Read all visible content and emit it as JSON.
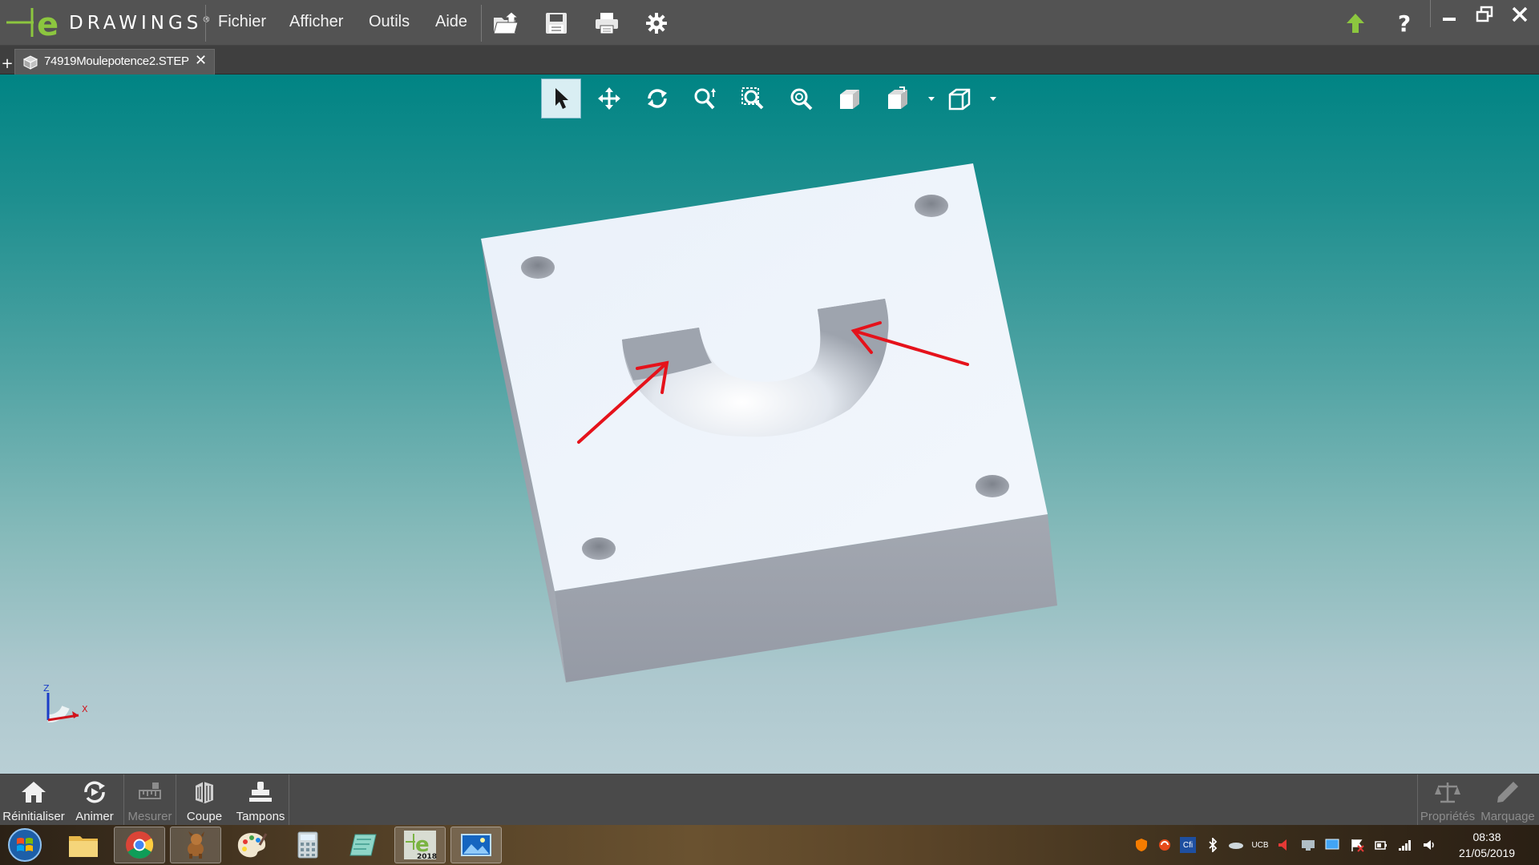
{
  "app": {
    "logo_letter": "e",
    "logo_name": "DRAWINGS",
    "logo_mark": "®"
  },
  "menu": [
    {
      "label": "Fichier"
    },
    {
      "label": "Afficher"
    },
    {
      "label": "Outils"
    },
    {
      "label": "Aide"
    }
  ],
  "toolbar_icons": [
    "open-icon",
    "save-icon",
    "print-icon",
    "settings-gear-icon"
  ],
  "title_right": {
    "update_icon": "update-arrow-icon",
    "help": "?",
    "window_controls": [
      "minimize-icon",
      "restore-icon",
      "close-icon"
    ]
  },
  "tabs": {
    "add": "+",
    "items": [
      {
        "label": "74919Moulepotence2.STEP",
        "close": "✕",
        "icon": "step-file-icon"
      }
    ]
  },
  "viewer_toolbar": {
    "tools": [
      "select-icon",
      "pan-icon",
      "rotate-icon",
      "zoom-icon",
      "zoom-to-area-icon",
      "zoom-to-fit-icon",
      "shaded-view-icon",
      "standard-views-icon",
      "display-style-icon"
    ],
    "active_tool": "select-icon"
  },
  "triad": {
    "z": "Z",
    "x": "X"
  },
  "colors": {
    "titlebar": "#535353",
    "viewport_top": "#008484",
    "viewport_bottom": "#b9cfd5",
    "model_top_face": "#eef3fa",
    "model_front_face": "#9ba0aa",
    "annotation_arrow": "#e5121b"
  },
  "bottom_tools": [
    {
      "label": "Réinitialiser",
      "icon": "home-icon",
      "enabled": true
    },
    {
      "label": "Animer",
      "icon": "animate-icon",
      "enabled": true
    },
    {
      "label": "Mesurer",
      "icon": "measure-icon",
      "enabled": false
    },
    {
      "label": "Coupe",
      "icon": "section-icon",
      "enabled": true
    },
    {
      "label": "Tampons",
      "icon": "stamp-icon",
      "enabled": true
    }
  ],
  "bottom_right_tools": [
    {
      "label": "Propriétés",
      "icon": "properties-scale-icon",
      "enabled": false
    },
    {
      "label": "Marquage",
      "icon": "markup-pen-icon",
      "enabled": false
    }
  ],
  "taskbar": {
    "apps": [
      "explorer-icon",
      "chrome-icon",
      "dog-app-icon",
      "paint-icon",
      "calculator-icon",
      "notes-icon",
      "edrawings-icon",
      "photo-viewer-icon"
    ],
    "edrawings_badge": "2018",
    "tray_text": [
      "UCB",
      "Cfi"
    ],
    "time": "08:38",
    "date": "21/05/2019"
  }
}
